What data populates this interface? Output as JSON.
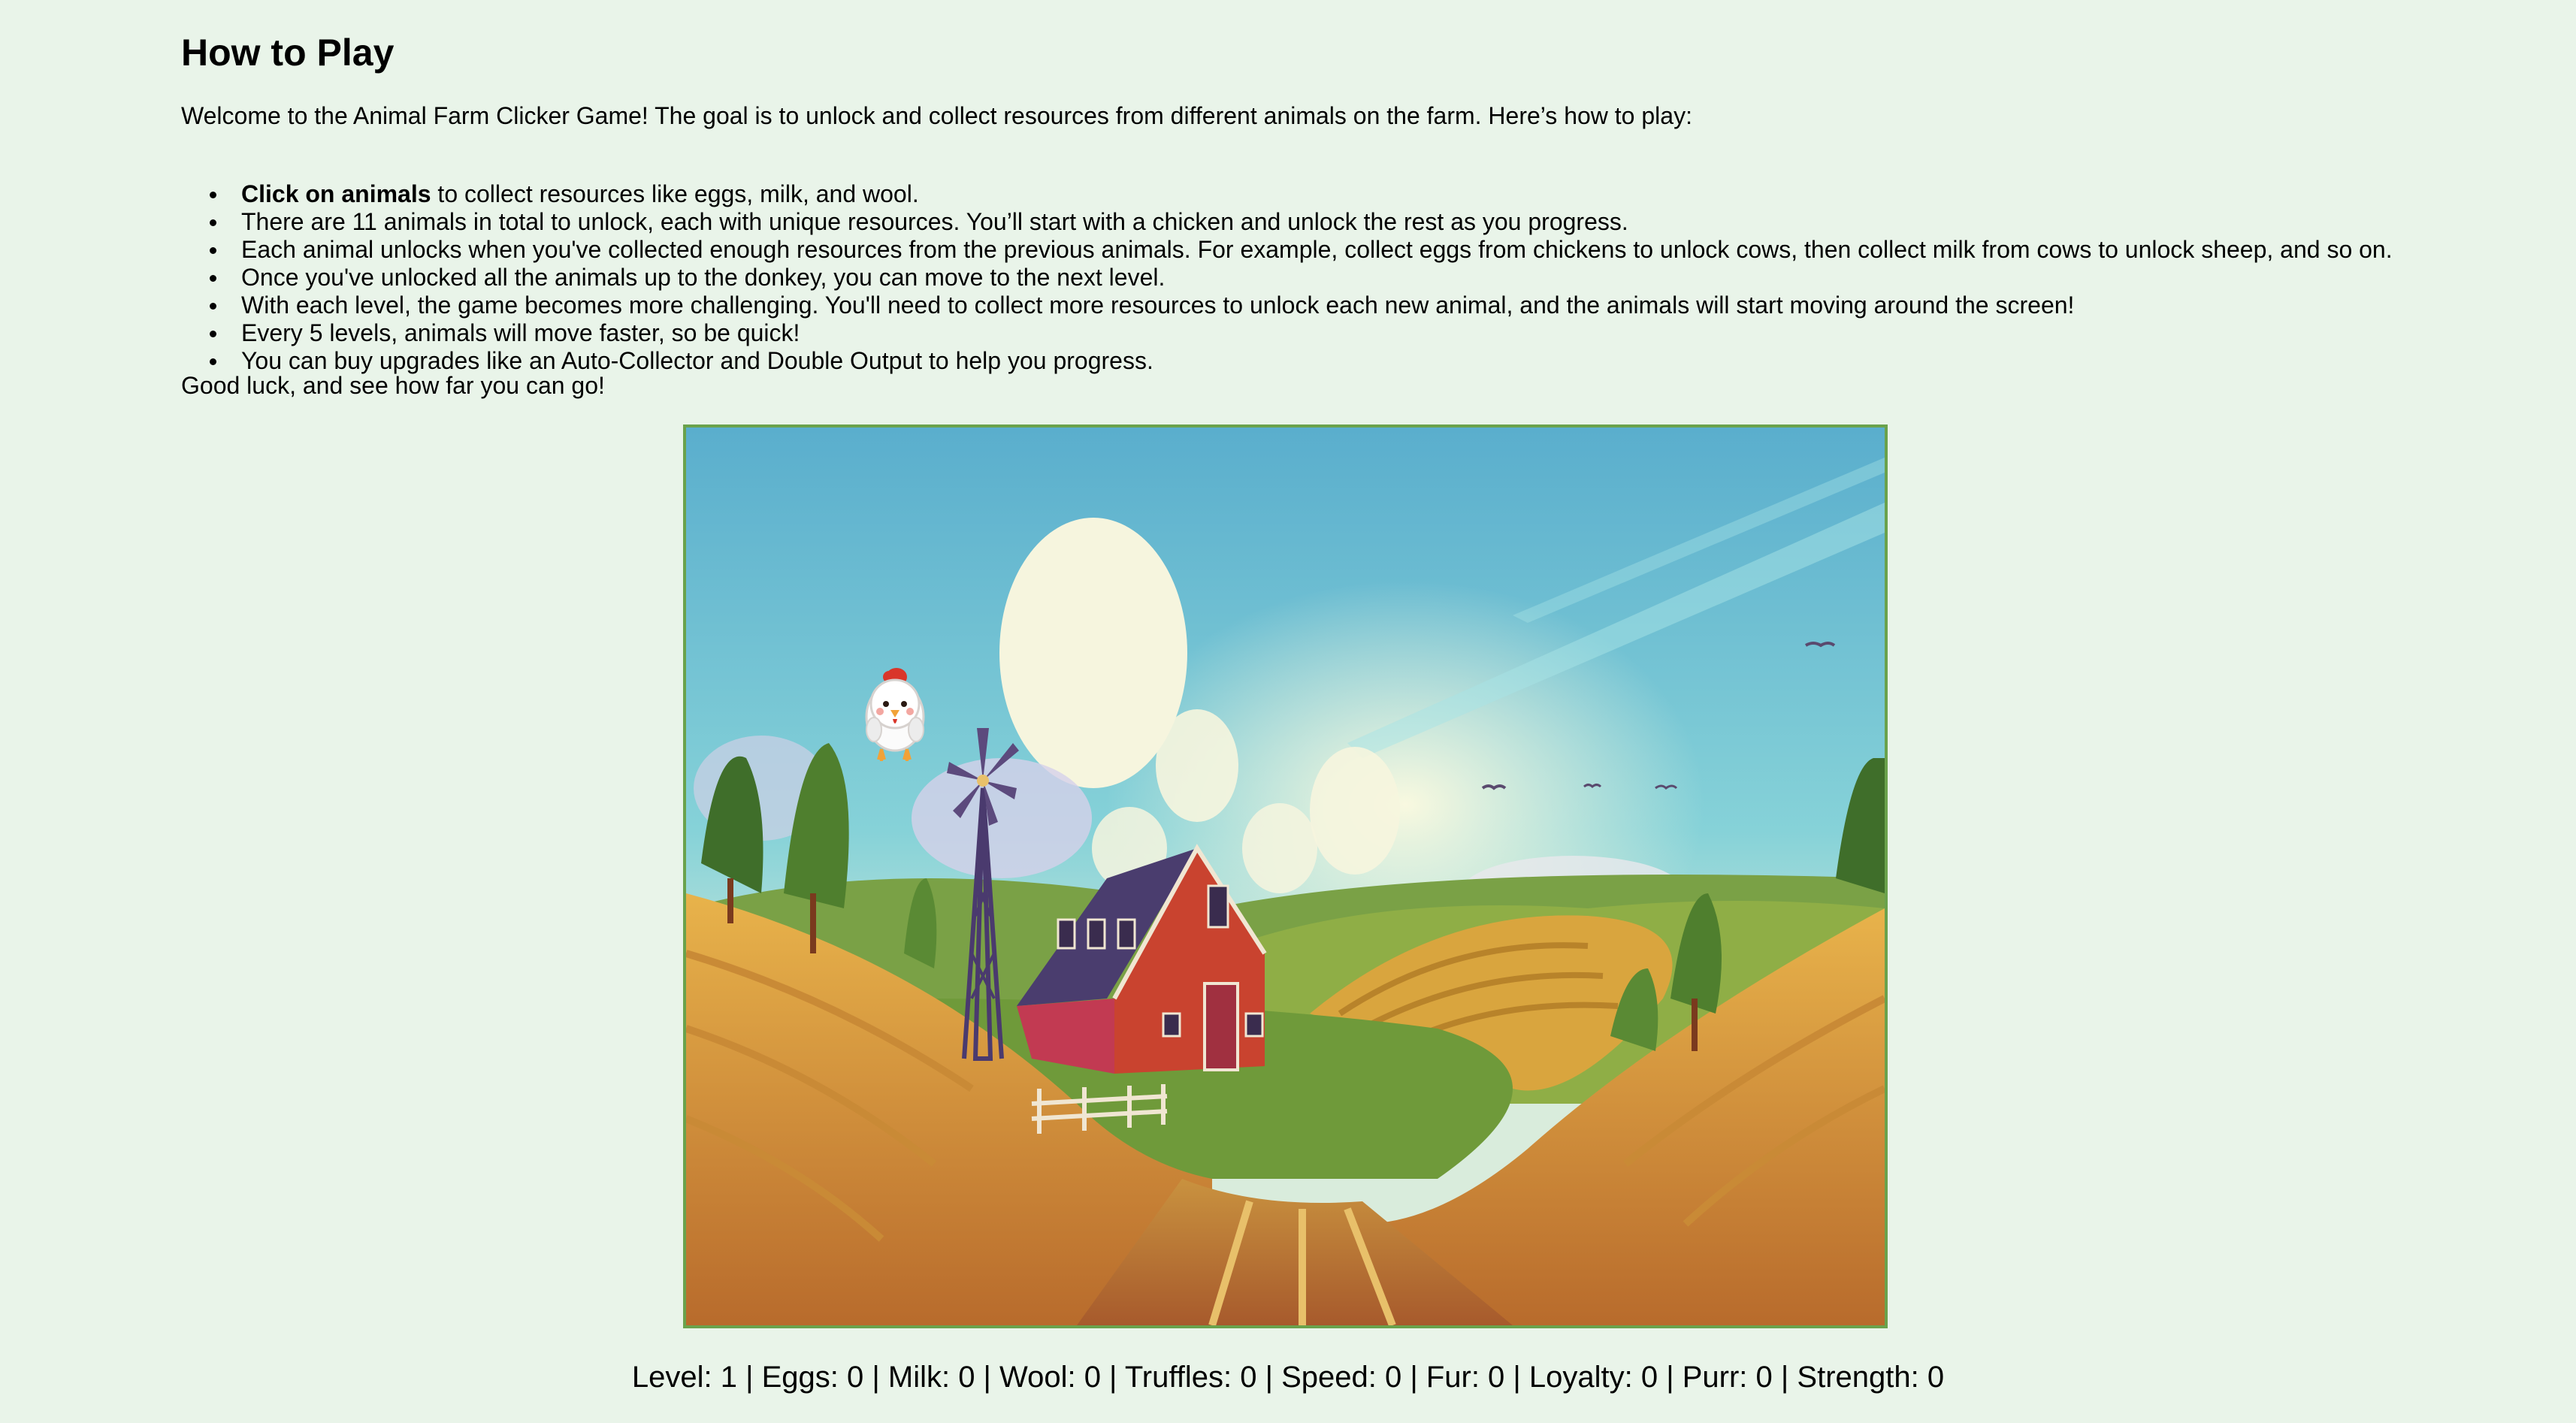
{
  "instructions": {
    "title": "How to Play",
    "intro": "Welcome to the Animal Farm Clicker Game! The goal is to unlock and collect resources from different animals on the farm. Here’s how to play:",
    "rules": [
      {
        "bold": "Click on animals",
        "text": " to collect resources like eggs, milk, and wool."
      },
      {
        "bold": "",
        "text": "There are 11 animals in total to unlock, each with unique resources. You’ll start with a chicken and unlock the rest as you progress."
      },
      {
        "bold": "",
        "text": "Each animal unlocks when you've collected enough resources from the previous animals. For example, collect eggs from chickens to unlock cows, then collect milk from cows to unlock sheep, and so on."
      },
      {
        "bold": "",
        "text": "Once you've unlocked all the animals up to the donkey, you can move to the next level."
      },
      {
        "bold": "",
        "text": "With each level, the game becomes more challenging. You'll need to collect more resources to unlock each new animal, and the animals will start moving around the screen!"
      },
      {
        "bold": "",
        "text": "Every 5 levels, animals will move faster, so be quick!"
      },
      {
        "bold": "",
        "text": "You can buy upgrades like an Auto-Collector and Double Output to help you progress."
      }
    ],
    "outro": "Good luck, and see how far you can go!"
  },
  "game": {
    "scene": "farm-landscape",
    "animals": [
      {
        "name": "chicken",
        "icon": "chicken-icon",
        "unlocked": true
      }
    ],
    "colors": {
      "border": "#6aa24c",
      "sky": "#62b4d1",
      "barn": "#c9432f"
    }
  },
  "stats": {
    "text": "Level: 1 | Eggs: 0 | Milk: 0 | Wool: 0 | Truffles: 0 | Speed: 0 | Fur: 0 | Loyalty: 0 | Purr: 0 | Strength: 0"
  }
}
